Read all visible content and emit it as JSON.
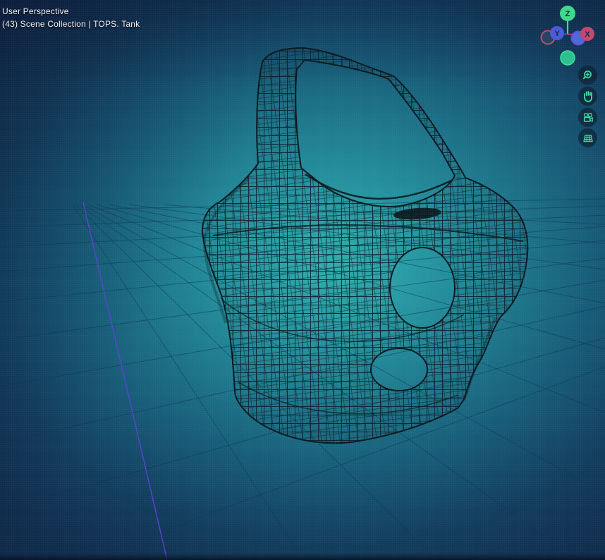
{
  "overlay": {
    "view_label": "User Perspective",
    "breadcrumb": "(43) Scene Collection | TOPS. Tank"
  },
  "gizmo": {
    "axis_z_label": "Z",
    "axis_y_label": "Y",
    "axis_x_label": "X"
  },
  "toolbar_icons": [
    "magnifier-plus-icon",
    "hand-icon",
    "camera-icon",
    "grid-icon"
  ],
  "colors": {
    "axis_x": "#c2486e",
    "axis_y": "#4a5cd6",
    "axis_z": "#40d98c",
    "axis_negative_y_ring": "#6b4be0",
    "floor_axis_line": "#5f3fd4",
    "icon_accent": "#38e0a0",
    "background_center": "#2dadad",
    "background_edge": "#0f2a4a",
    "wireframe": "#0c1d24",
    "hud_text": "#f4f4f4"
  }
}
